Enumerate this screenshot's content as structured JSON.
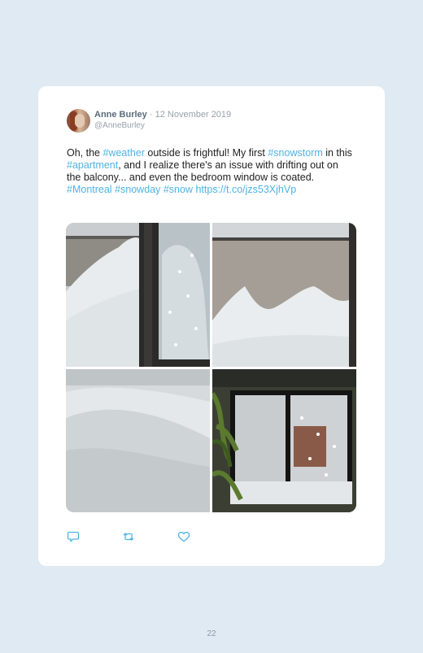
{
  "tweet": {
    "author_name": "Anne Burley",
    "separator": "·",
    "date": "12 November 2019",
    "handle": "@AnneBurley",
    "text_segments": [
      {
        "text": "Oh, the ",
        "tag": false
      },
      {
        "text": "#weather",
        "tag": true
      },
      {
        "text": " outside is frightful! My first ",
        "tag": false
      },
      {
        "text": "#snowstorm",
        "tag": true
      },
      {
        "text": " in this ",
        "tag": false
      },
      {
        "text": "#apartment",
        "tag": true
      },
      {
        "text": ", and I realize there's an issue with drifting out on the balcony... and even the bedroom window is coated.",
        "tag": false
      }
    ],
    "tags_line": [
      {
        "text": "#Montreal",
        "tag": true
      },
      {
        "text": " ",
        "tag": false
      },
      {
        "text": "#snowday",
        "tag": true
      },
      {
        "text": " ",
        "tag": false
      },
      {
        "text": "#snow",
        "tag": true
      },
      {
        "text": " ",
        "tag": false
      },
      {
        "text": "https://t.co/jzs53XjhVp",
        "tag": true
      }
    ],
    "photos": [
      "balcony-snow-drift-photo",
      "balcony-wall-snow-photo",
      "snow-surface-photo",
      "bedroom-window-snow-photo"
    ],
    "actions": [
      "reply-icon",
      "retweet-icon",
      "like-icon"
    ]
  },
  "page_number": "22",
  "colors": {
    "background": "#dfeaf3",
    "card": "#ffffff",
    "link": "#4fb2e4",
    "meta": "#96a0aa"
  }
}
